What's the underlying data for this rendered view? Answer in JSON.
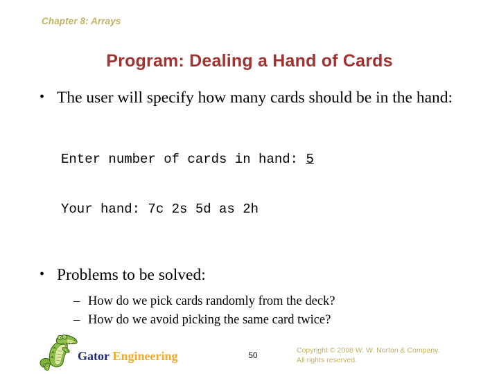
{
  "slide": {
    "chapter_header": "Chapter 8: Arrays",
    "title": "Program: Dealing a Hand of Cards",
    "bullets": [
      {
        "marker": "•",
        "text": "The user will specify how many cards should be in the hand:"
      },
      {
        "marker": "•",
        "text": "Problems to be solved:"
      }
    ],
    "code_block": {
      "line1_prompt": "Enter number of cards in hand: ",
      "line1_input": "5",
      "line2": "Your hand: 7c 2s 5d as 2h"
    },
    "sub_bullets": [
      {
        "marker": "–",
        "text": "How do we pick cards randomly from the deck?"
      },
      {
        "marker": "–",
        "text": "How do we avoid picking the same card twice?"
      }
    ]
  },
  "footer": {
    "logo": {
      "icon": "alligator-mascot-icon",
      "word1": "Gator",
      "word2": "Engineering"
    },
    "page_number": "50",
    "copyright_line1": "Copyright © 2008 W. W. Norton & Company.",
    "copyright_line2": "All rights reserved."
  },
  "colors": {
    "header_gold": "#bfb264",
    "title_red": "#a0322f",
    "logo_blue": "#1d2a7c",
    "logo_orange": "#f0a92a",
    "body_black": "#000000",
    "background": "#ffffff"
  }
}
